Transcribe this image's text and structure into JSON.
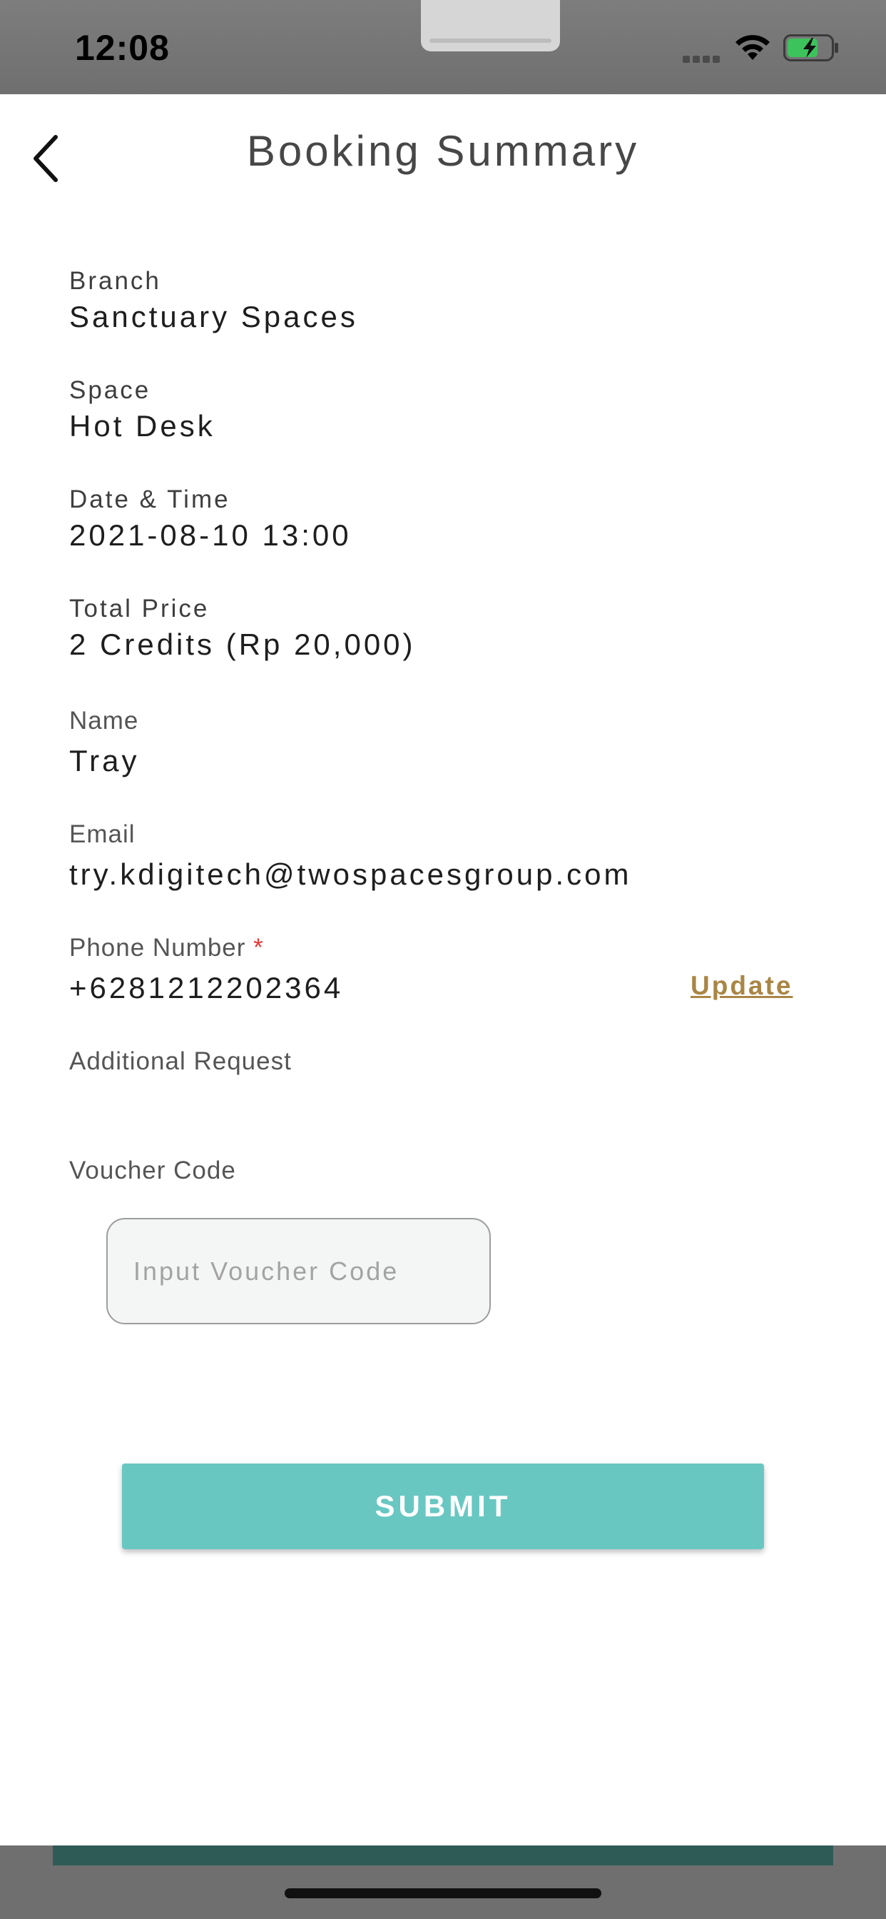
{
  "status_bar": {
    "time": "12:08"
  },
  "header": {
    "title": "Booking Summary",
    "back_icon": "chevron-left-icon"
  },
  "fields": {
    "branch": {
      "label": "Branch",
      "value": "Sanctuary Spaces"
    },
    "space": {
      "label": "Space",
      "value": "Hot Desk"
    },
    "date_time": {
      "label": "Date & Time",
      "value": "2021-08-10 13:00"
    },
    "total_price": {
      "label": "Total Price",
      "value": "2 Credits (Rp 20,000)"
    },
    "name": {
      "label": "Name",
      "value": "Tray"
    },
    "email": {
      "label": "Email",
      "value": "try.kdigitech@twospacesgroup.com"
    },
    "phone": {
      "label": "Phone Number",
      "required_mark": "*",
      "value": "+6281212202364",
      "update_label": "Update"
    },
    "additional_request": {
      "label": "Additional Request"
    },
    "voucher": {
      "label": "Voucher Code",
      "placeholder": "Input Voucher Code",
      "value": ""
    }
  },
  "submit": {
    "label": "SUBMIT"
  },
  "colors": {
    "accent_teal": "#69c7c2",
    "link_gold": "#a98645",
    "required_red": "#e53935"
  }
}
